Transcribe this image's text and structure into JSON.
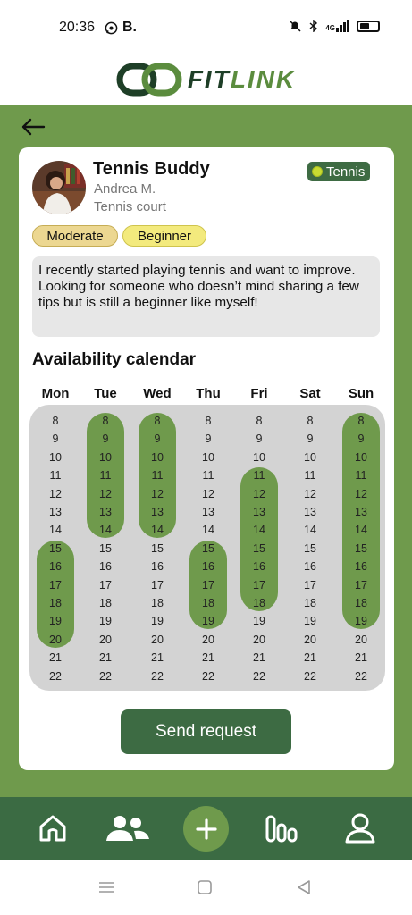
{
  "status": {
    "time": "20:36",
    "notif_icons": [
      "whatsapp-icon",
      "b-icon"
    ],
    "notif_b": "B.",
    "signal_text": "4G"
  },
  "brand": {
    "part1": "FIT",
    "part2": "LINK"
  },
  "card": {
    "title": "Tennis Buddy",
    "name": "Andrea M.",
    "place": "Tennis court",
    "sport": "Tennis",
    "level": "Moderate",
    "experience": "Beginner",
    "description": "I recently started playing tennis and want to improve. Looking for someone who doesn’t mind sharing a few tips but is still a beginner like myself!"
  },
  "calendar": {
    "title": "Availability calendar",
    "days": [
      "Mon",
      "Tue",
      "Wed",
      "Thu",
      "Fri",
      "Sat",
      "Sun"
    ],
    "hours": [
      8,
      9,
      10,
      11,
      12,
      13,
      14,
      15,
      16,
      17,
      18,
      19,
      20,
      21,
      22
    ],
    "availability": {
      "Mon": [
        [
          15,
          20
        ]
      ],
      "Tue": [
        [
          8,
          14
        ]
      ],
      "Wed": [
        [
          8,
          14
        ]
      ],
      "Thu": [
        [
          15,
          19
        ]
      ],
      "Fri": [
        [
          11,
          18
        ]
      ],
      "Sat": [],
      "Sun": [
        [
          8,
          19
        ]
      ]
    }
  },
  "actions": {
    "send_request": "Send request"
  },
  "nav": {
    "items": [
      "home-icon",
      "friends-icon",
      "add-icon",
      "stats-icon",
      "profile-icon"
    ]
  },
  "colors": {
    "primary_green": "#6f9a4c",
    "dark_green": "#3b6b43",
    "level_tag": "#ecd791",
    "experience_tag": "#f3ea7d"
  }
}
